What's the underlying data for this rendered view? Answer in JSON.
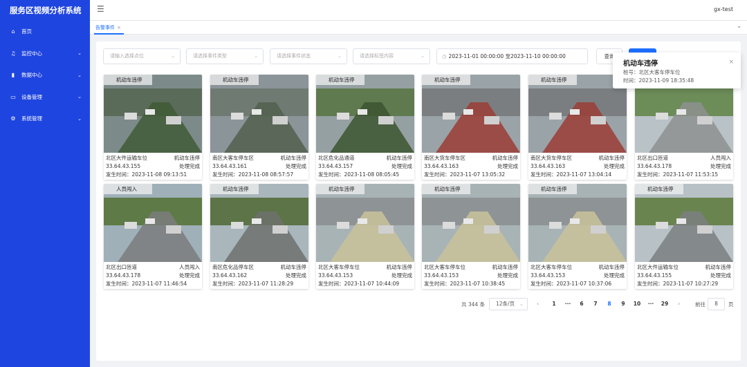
{
  "app": {
    "title": "服务区视频分析系统",
    "user": "gx-test"
  },
  "sidebar": {
    "items": [
      {
        "label": "首页",
        "icon": "home-icon",
        "has_children": false
      },
      {
        "label": "监控中心",
        "icon": "bell-icon",
        "has_children": true
      },
      {
        "label": "数据中心",
        "icon": "bar-chart-icon",
        "has_children": true
      },
      {
        "label": "设备管理",
        "icon": "monitor-icon",
        "has_children": true
      },
      {
        "label": "系统管理",
        "icon": "gear-icon",
        "has_children": true
      }
    ]
  },
  "tabs": [
    {
      "label": "告警事件",
      "active": true
    }
  ],
  "filters": {
    "point_placeholder": "请输入选择点位",
    "event_type_placeholder": "请选择事件类型",
    "event_status_placeholder": "请选择事件状态",
    "tag_placeholder": "请选择标签内容",
    "date_range": "2023-11-01 00:00:00 至2023-11-10 00:00:00",
    "query_label": "查询",
    "blue_button_label": ""
  },
  "events": [
    {
      "location": "北区大件运输车位",
      "type": "机动车违停",
      "ip": "33.64.43.155",
      "status": "处理完成",
      "time": "发生时间：2023-11-08 09:13:51",
      "badge": "机动车违停"
    },
    {
      "location": "南区大客车停车区",
      "type": "机动车违停",
      "ip": "33.64.43.161",
      "status": "处理完成",
      "time": "发生时间：2023-11-08 08:57:57",
      "badge": "机动车违停"
    },
    {
      "location": "北区危化品通道",
      "type": "机动车违停",
      "ip": "33.64.43.157",
      "status": "处理完成",
      "time": "发生时间：2023-11-08 08:05:45",
      "badge": "机动车违停"
    },
    {
      "location": "南区大货车停车区",
      "type": "机动车违停",
      "ip": "33.64.43.163",
      "status": "处理完成",
      "time": "发生时间：2023-11-07 13:05:32",
      "badge": "机动车违停"
    },
    {
      "location": "南区大货车停车区",
      "type": "机动车违停",
      "ip": "33.64.43.163",
      "status": "处理完成",
      "time": "发生时间：2023-11-07 13:04:14",
      "badge": "机动车违停"
    },
    {
      "location": "北区出口匝道",
      "type": "人员闯入",
      "ip": "33.64.43.178",
      "status": "处理完成",
      "time": "发生时间：2023-11-07 11:53:15",
      "badge": ""
    },
    {
      "location": "北区出口匝道",
      "type": "人员闯入",
      "ip": "33.64.43.178",
      "status": "处理完成",
      "time": "发生时间：2023-11-07 11:46:54",
      "badge": "人员闯入"
    },
    {
      "location": "南区危化品停车区",
      "type": "机动车违停",
      "ip": "33.64.43.162",
      "status": "处理完成",
      "time": "发生时间：2023-11-07 11:28:29",
      "badge": "机动车违停"
    },
    {
      "location": "北区大客车停车位",
      "type": "机动车违停",
      "ip": "33.64.43.153",
      "status": "处理完成",
      "time": "发生时间：2023-11-07 10:44:09",
      "badge": "机动车违停"
    },
    {
      "location": "北区大客车停车位",
      "type": "机动车违停",
      "ip": "33.64.43.153",
      "status": "处理完成",
      "time": "发生时间：2023-11-07 10:38:45",
      "badge": "机动车违停"
    },
    {
      "location": "北区大客车停车位",
      "type": "机动车违停",
      "ip": "33.64.43.153",
      "status": "处理完成",
      "time": "发生时间：2023-11-07 10:37:06",
      "badge": "机动车违停"
    },
    {
      "location": "北区大件运输车位",
      "type": "机动车违停",
      "ip": "33.64.43.155",
      "status": "处理完成",
      "time": "发生时间：2023-11-07 10:27:29",
      "badge": "机动车违停"
    }
  ],
  "pagination": {
    "total": "共 344 条",
    "page_size": "12条/页",
    "pages": [
      "1",
      "···",
      "6",
      "7",
      "8",
      "9",
      "10",
      "···",
      "29"
    ],
    "current": "8",
    "goto_label": "前往",
    "goto_value": "8",
    "page_suffix": "页"
  },
  "notification": {
    "title": "机动车违停",
    "line1": "桩号：北区大客车停车位",
    "line2": "时间：2023-11-09 18:35:48"
  },
  "colors": {
    "sidebar": "#1f45e0",
    "accent": "#1f6fff"
  }
}
